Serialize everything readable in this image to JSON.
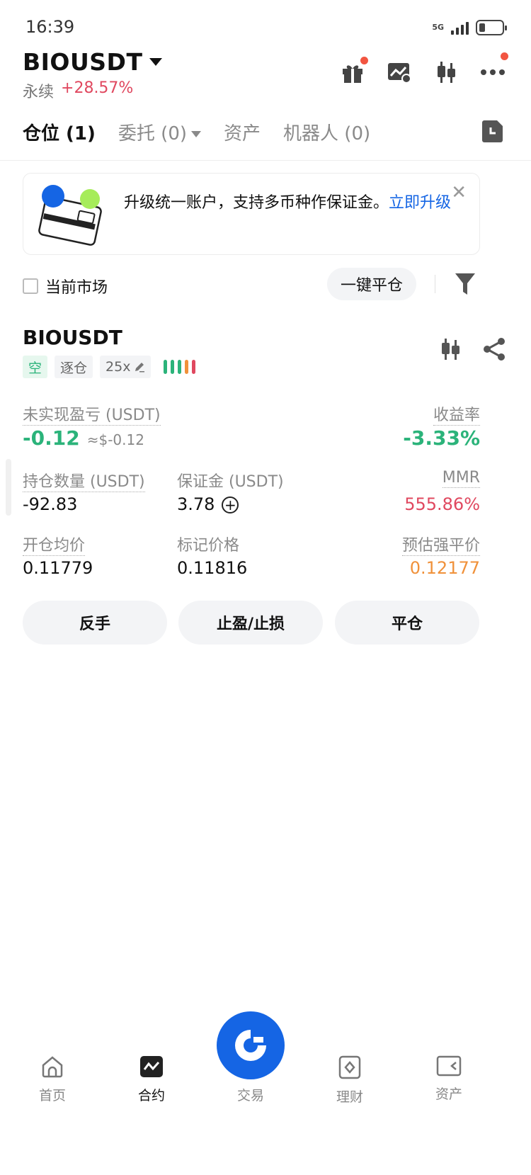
{
  "status": {
    "time": "16:39",
    "network": "5G"
  },
  "header": {
    "pair": "BIOUSDT",
    "type": "永续",
    "change": "+28.57%"
  },
  "tabs": [
    {
      "label": "仓位 (1)"
    },
    {
      "label": "委托 (0)"
    },
    {
      "label": "资产"
    },
    {
      "label": "机器人 (0)"
    }
  ],
  "banner": {
    "text": "升级统一账户，支持多币种作保证金。",
    "link": "立即升级"
  },
  "filter": {
    "checkbox_label": "当前市场",
    "close_all": "一键平仓"
  },
  "position": {
    "symbol": "BIOUSDT",
    "side": "空",
    "margin_mode": "逐仓",
    "leverage": "25x",
    "unrealized_label": "未实现盈亏 (USDT)",
    "unrealized_value": "-0.12",
    "unrealized_usd": "≈$-0.12",
    "roe_label": "收益率",
    "roe_value": "-3.33%",
    "size_label": "持仓数量 (USDT)",
    "size_value": "-92.83",
    "margin_label": "保证金 (USDT)",
    "margin_value": "3.78",
    "mmr_label": "MMR",
    "mmr_value": "555.86%",
    "entry_label": "开仓均价",
    "entry_value": "0.11779",
    "mark_label": "标记价格",
    "mark_value": "0.11816",
    "liq_label": "预估强平价",
    "liq_value": "0.12177"
  },
  "actions": {
    "reverse": "反手",
    "tpsl": "止盈/止损",
    "close": "平仓"
  },
  "nav": {
    "home": "首页",
    "futures": "合约",
    "trade": "交易",
    "earn": "理财",
    "assets": "资产"
  },
  "colors": {
    "accent": "#1565e4",
    "up": "#2bb37a",
    "down": "#e0485f",
    "warn": "#f0913a"
  },
  "risk_level_colors": [
    "#2bb37a",
    "#2bb37a",
    "#2bb37a",
    "#f0913a",
    "#e0485f"
  ]
}
